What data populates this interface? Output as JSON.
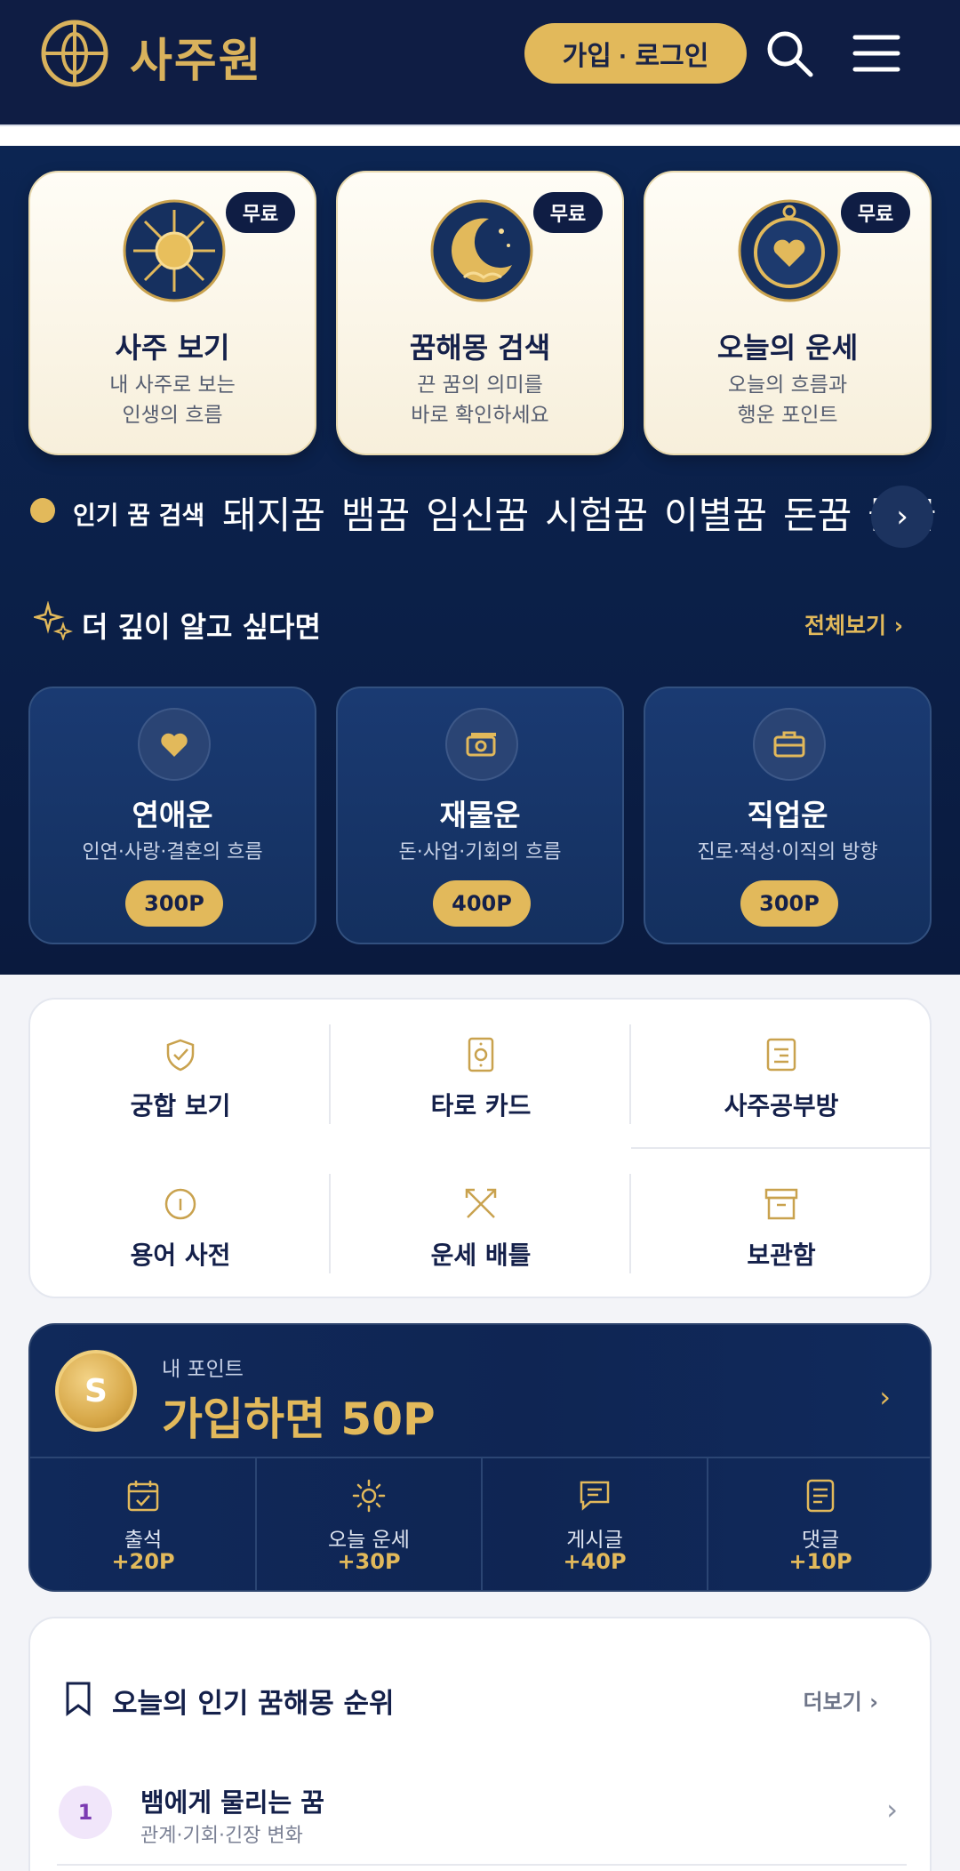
{
  "header": {
    "logo_text": "사주원",
    "login_label": "가입 · 로그인",
    "brand_color": "#0f1d44",
    "accent_color": "#e2b95b"
  },
  "free_cards": [
    {
      "badge": "무료",
      "title": "사주 보기",
      "desc1": "내 사주로 보는",
      "desc2": "인생의 흐름",
      "icon": "sun-icon"
    },
    {
      "badge": "무료",
      "title": "꿈해몽 검색",
      "desc1": "끈 꿈의 의미를",
      "desc2": "바로 확인하세요",
      "icon": "moon-icon"
    },
    {
      "badge": "무료",
      "title": "오늘의 운세",
      "desc1": "오늘의 흐름과",
      "desc2": "행운 포인트",
      "icon": "compass-icon"
    }
  ],
  "popular": {
    "label": "인기 꿈 검색",
    "terms": [
      "돼지꿈",
      "뱀꿈",
      "임신꿈",
      "시험꿈",
      "이별꿈",
      "돈꿈",
      "물꿈"
    ],
    "next_label": "›"
  },
  "deep": {
    "title": "더 깊이 알고 싶다면",
    "all_label": "전체보기 ›",
    "cards": [
      {
        "name": "연애운",
        "desc": "인연·사랑·결혼의 흐름",
        "price": "300P",
        "icon": "heart-icon"
      },
      {
        "name": "재물운",
        "desc": "돈·사업·기회의 흐름",
        "price": "400P",
        "icon": "money-icon"
      },
      {
        "name": "직업운",
        "desc": "진로·적성·이직의 방향",
        "price": "300P",
        "icon": "briefcase-icon"
      }
    ]
  },
  "menu": [
    {
      "label": "궁합 보기",
      "icon": "heart-shield-icon"
    },
    {
      "label": "타로 카드",
      "icon": "tarot-card-icon"
    },
    {
      "label": "사주공부방",
      "icon": "book-icon"
    },
    {
      "label": "용어 사전",
      "icon": "info-icon"
    },
    {
      "label": "운세 배틀",
      "icon": "crossed-arrows-icon"
    },
    {
      "label": "보관함",
      "icon": "archive-box-icon"
    }
  ],
  "points": {
    "coin_letter": "S",
    "label": "내 포인트",
    "value": "가입하면 50P",
    "arrow": "›",
    "items": [
      {
        "name": "출석",
        "value": "+20P",
        "icon": "calendar-check-icon"
      },
      {
        "name": "오늘 운세",
        "value": "+30P",
        "icon": "sun-outline-icon"
      },
      {
        "name": "게시글",
        "value": "+40P",
        "icon": "chat-icon"
      },
      {
        "name": "댓글",
        "value": "+10P",
        "icon": "note-icon"
      }
    ]
  },
  "ranking": {
    "title": "오늘의 인기 꿈해몽 순위",
    "more_label": "더보기 ›",
    "rows": [
      {
        "rank": "1",
        "name": "뱀에게 물리는 꿈",
        "sub": "관계·기회·긴장 변화"
      }
    ]
  }
}
